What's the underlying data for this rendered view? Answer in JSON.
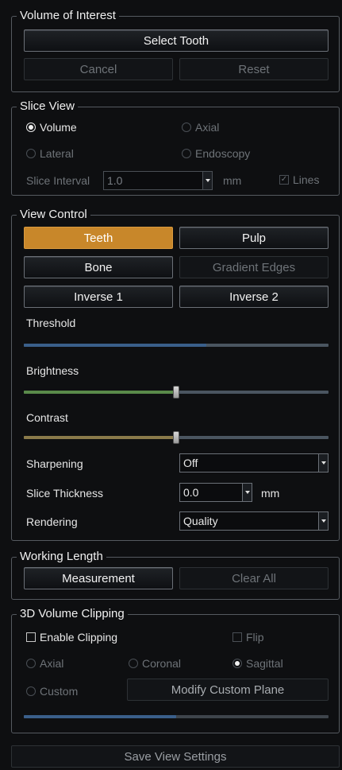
{
  "voi": {
    "title": "Volume of Interest",
    "select_tooth": "Select Tooth",
    "cancel": "Cancel",
    "reset": "Reset"
  },
  "slice_view": {
    "title": "Slice View",
    "options": [
      "Volume",
      "Axial",
      "Lateral",
      "Endoscopy"
    ],
    "selected": "Volume",
    "interval_label": "Slice Interval",
    "interval_value": "1.0",
    "interval_unit": "mm",
    "lines_label": "Lines",
    "lines_checked": true
  },
  "view_control": {
    "title": "View Control",
    "teeth": "Teeth",
    "pulp": "Pulp",
    "bone": "Bone",
    "gradient_edges": "Gradient Edges",
    "inverse1": "Inverse 1",
    "inverse2": "Inverse 2",
    "threshold_label": "Threshold",
    "threshold_value": 0.6,
    "brightness_label": "Brightness",
    "brightness_value": 0.5,
    "contrast_label": "Contrast",
    "contrast_value": 0.5,
    "sharpening_label": "Sharpening",
    "sharpening_value": "Off",
    "thickness_label": "Slice Thickness",
    "thickness_value": "0.0",
    "thickness_unit": "mm",
    "rendering_label": "Rendering",
    "rendering_value": "Quality"
  },
  "working_length": {
    "title": "Working Length",
    "measurement": "Measurement",
    "clear_all": "Clear All"
  },
  "clipping": {
    "title": "3D Volume Clipping",
    "enable_label": "Enable Clipping",
    "enable_checked": false,
    "flip_label": "Flip",
    "options": [
      "Axial",
      "Coronal",
      "Sagittal",
      "Custom"
    ],
    "selected": "Sagittal",
    "modify_plane": "Modify Custom Plane",
    "clip_position": 0.5
  },
  "footer": {
    "save": "Save View Settings"
  },
  "colors": {
    "accent": "#c8872a",
    "threshold_fill": "#3a5f8a",
    "brightness_fill": "#5a8a4a",
    "contrast_fill": "#8a7a4a"
  }
}
